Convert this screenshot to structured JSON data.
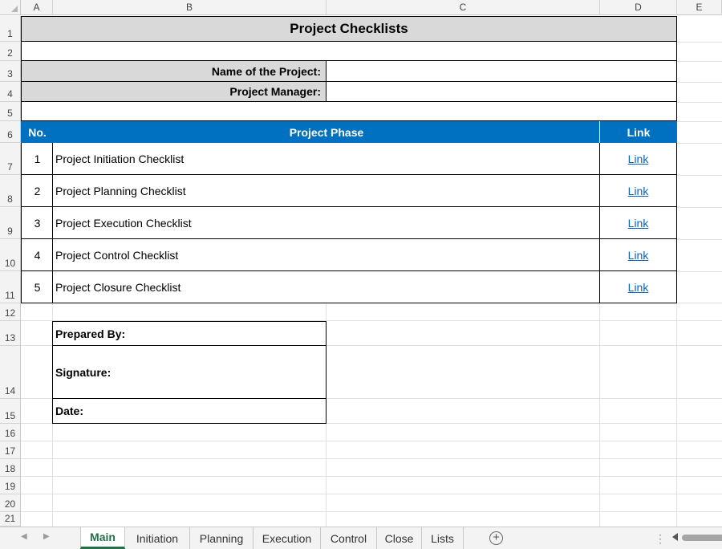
{
  "columns": [
    "A",
    "B",
    "C",
    "D",
    "E"
  ],
  "rows": [
    "1",
    "2",
    "3",
    "4",
    "5",
    "6",
    "7",
    "8",
    "9",
    "10",
    "11",
    "12",
    "13",
    "14",
    "15",
    "16",
    "17",
    "18",
    "19",
    "20",
    "21"
  ],
  "sheet": {
    "title": "Project Checklists",
    "project_name_label": "Name of the Project:",
    "project_manager_label": "Project Manager:",
    "project_name_value": "",
    "project_manager_value": ""
  },
  "table": {
    "headers": {
      "no": "No.",
      "phase": "Project Phase",
      "link": "Link"
    },
    "rows": [
      {
        "no": "1",
        "phase": "Project Initiation Checklist",
        "link": "Link"
      },
      {
        "no": "2",
        "phase": "Project Planning Checklist",
        "link": "Link"
      },
      {
        "no": "3",
        "phase": "Project Execution Checklist",
        "link": "Link"
      },
      {
        "no": "4",
        "phase": "Project Control Checklist",
        "link": "Link"
      },
      {
        "no": "5",
        "phase": "Project Closure Checklist",
        "link": "Link"
      }
    ]
  },
  "footer": {
    "prepared_by": "Prepared By:",
    "signature": "Signature:",
    "date": "Date:"
  },
  "tabs": [
    "Main",
    "Initiation",
    "Planning",
    "Execution",
    "Control",
    "Close",
    "Lists"
  ],
  "active_tab": "Main",
  "icons": {
    "nav_prev": "chevron-left-icon",
    "nav_next": "chevron-right-icon",
    "add_sheet": "plus-circle-icon",
    "more": "vertical-dots-icon"
  },
  "colors": {
    "header_fill": "#0070c0",
    "label_fill": "#d9d9d9",
    "link": "#0563c1",
    "active_tab": "#217346"
  }
}
